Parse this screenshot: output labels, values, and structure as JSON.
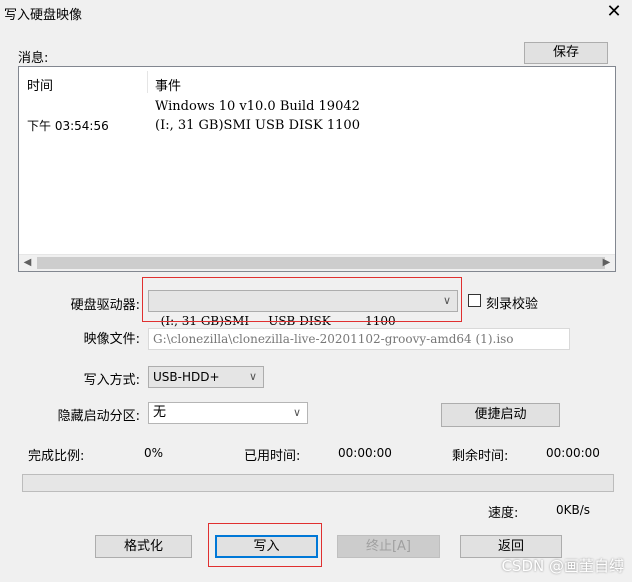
{
  "window": {
    "title": "写入硬盘映像",
    "close_glyph": "✕"
  },
  "messages": {
    "label": "消息:",
    "save_label": "保存",
    "col_time": "时间",
    "col_event": "事件",
    "rows": [
      {
        "time": "",
        "event": "Windows 10 v10.0 Build 19042"
      },
      {
        "time": "下午 03:54:56",
        "event": "(I:, 31 GB)SMI     USB DISK         1100"
      }
    ]
  },
  "drive": {
    "label": "硬盘驱动器:",
    "value": "(I:, 31 GB)SMI     USB DISK         1100",
    "verify_label": "刻录校验"
  },
  "image_file": {
    "label": "映像文件:",
    "value": "G:\\clonezilla\\clonezilla-live-20201102-groovy-amd64 (1).iso"
  },
  "write_method": {
    "label": "写入方式:",
    "value": "USB-HDD+"
  },
  "hidden_partition": {
    "label": "隐藏启动分区:",
    "value": "无"
  },
  "quick_boot_label": "便捷启动",
  "status": {
    "progress_label": "完成比例:",
    "progress_value": "0%",
    "elapsed_label": "已用时间:",
    "elapsed_value": "00:00:00",
    "remaining_label": "剩余时间:",
    "remaining_value": "00:00:00",
    "speed_label": "速度:",
    "speed_value": "0KB/s",
    "progress_fraction": 0
  },
  "buttons": {
    "format": "格式化",
    "write": "写入",
    "stop": "终止[A]",
    "back": "返回"
  },
  "watermark": "CSDN @画董自缚"
}
